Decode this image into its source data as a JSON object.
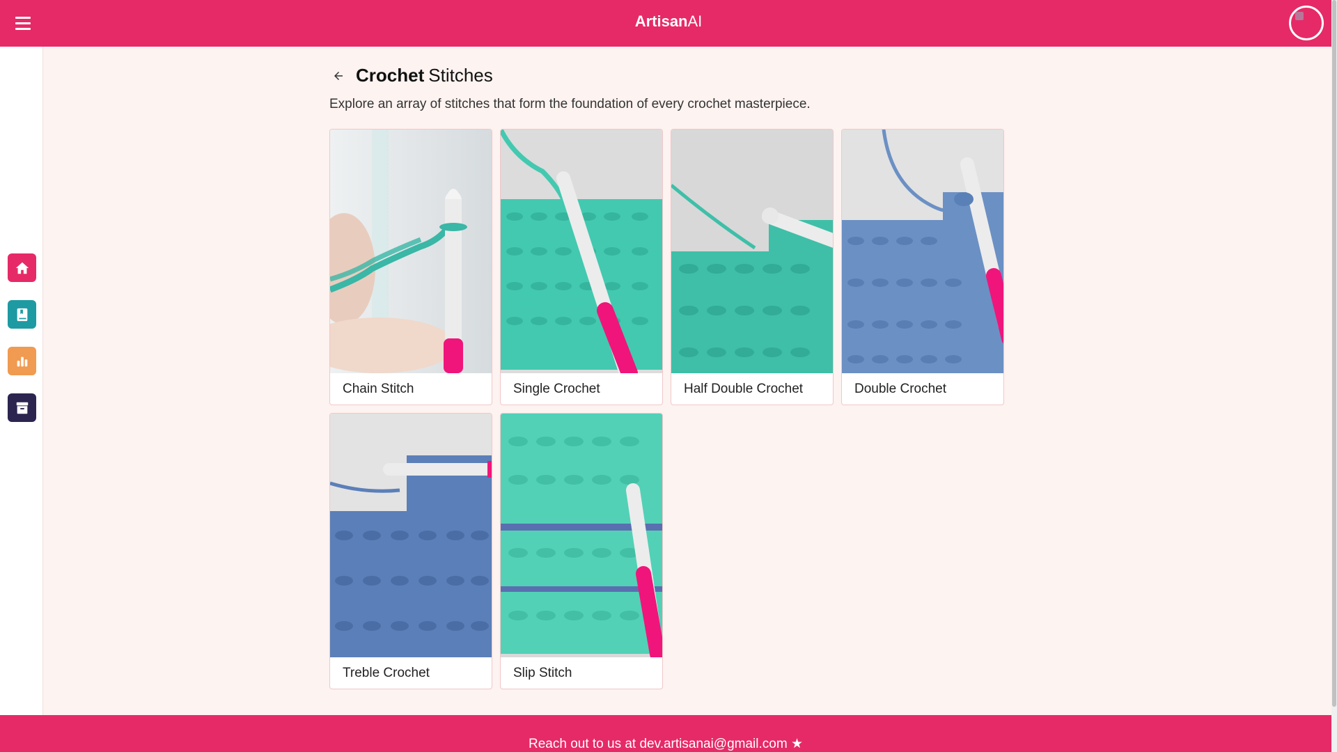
{
  "header": {
    "brand_bold": "Artisan",
    "brand_light": "AI",
    "menu_icon": "hamburger-menu-icon",
    "avatar_icon": "user-avatar"
  },
  "sidebar": {
    "items": [
      {
        "name": "home",
        "icon": "home-icon",
        "color": "#e62a67"
      },
      {
        "name": "book",
        "icon": "book-icon",
        "color": "#1e9aa3"
      },
      {
        "name": "stats",
        "icon": "bar-chart-icon",
        "color": "#f09a52"
      },
      {
        "name": "archive",
        "icon": "archive-icon",
        "color": "#2b2550"
      }
    ]
  },
  "page": {
    "back_icon": "arrow-left-icon",
    "title_bold": "Crochet",
    "title_light": "Stitches",
    "subtitle": "Explore an array of stitches that form the foundation of every crochet masterpiece."
  },
  "stitches": [
    {
      "label": "Chain Stitch",
      "yarn_color": "#3ab7a6",
      "bg": "#dfe3e6"
    },
    {
      "label": "Single Crochet",
      "yarn_color": "#43c9b0",
      "bg": "#dcdcdc"
    },
    {
      "label": "Half Double Crochet",
      "yarn_color": "#3fbfa8",
      "bg": "#d8d8d8"
    },
    {
      "label": "Double Crochet",
      "yarn_color": "#6b90c4",
      "bg": "#e2e2e2"
    },
    {
      "label": "Treble Crochet",
      "yarn_color": "#5b7fb8",
      "bg": "#e3e3e3"
    },
    {
      "label": "Slip Stitch",
      "yarn_color": "#52d1b6",
      "bg": "#d9d9d9"
    }
  ],
  "footer": {
    "text": "Reach out to us at dev.artisanai@gmail.com",
    "icon": "star-icon"
  },
  "colors": {
    "primary": "#e62a67",
    "background": "#fdf3f1",
    "hook_pink": "#f0157a",
    "hook_white": "#ececec"
  }
}
